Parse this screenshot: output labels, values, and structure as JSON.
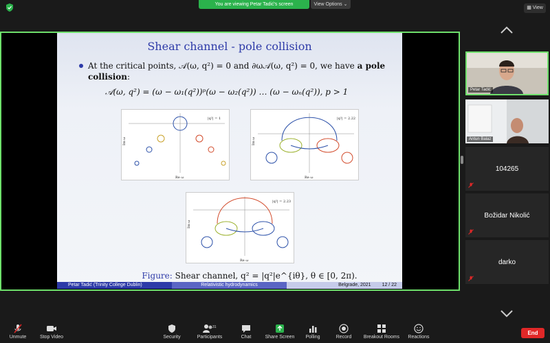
{
  "topbar": {
    "banner_text": "You are viewing Petar Tadić's screen",
    "view_options_label": "View Options ⌄",
    "view_label": "View"
  },
  "slide": {
    "title": "Shear channel - pole collision",
    "bullet": "At the critical points, 𝒜(ω, q²) = 0 and ∂ω𝒜(ω, q²) = 0, we have",
    "bullet_bold": "a pole collision",
    "formula": "𝒜(ω, q²) = (ω − ω₁(q²))ᵖ(ω − ω₂(q²)) … (ω − ωₙ(q²)),     p > 1",
    "plot1_label": "|q²| = 1",
    "plot2_label": "|q²| = 2.22",
    "plot3_label": "|q²| = 2.23",
    "caption_label": "Figure:",
    "caption_text": "Shear channel, q² = |q²|e^{iθ},   θ ∈ [0, 2π).",
    "footer_author": "Petar Tadić  (Trinity College Dublin)",
    "footer_title": "Relativistic hydrodynamics",
    "footer_place": "Belgrade, 2021",
    "footer_page": "12 / 22",
    "axis_x": "Re ω",
    "axis_y": "Im ω"
  },
  "participants": [
    {
      "name": "Petar Tadić"
    },
    {
      "name": "Antun Balaz"
    },
    {
      "name": "104265"
    },
    {
      "name": "Božidar Nikolić"
    },
    {
      "name": "darko"
    }
  ],
  "toolbar": {
    "unmute": "Unmute",
    "stop_video": "Stop Video",
    "security": "Security",
    "participants": "Participants",
    "participants_count": "31",
    "chat": "Chat",
    "share_screen": "Share Screen",
    "polling": "Polling",
    "record": "Record",
    "breakout": "Breakout Rooms",
    "reactions": "Reactions",
    "end": "End"
  },
  "colors": {
    "active_green": "#6ee06b",
    "end_red": "#e02828",
    "slide_blue": "#2d3aa8"
  }
}
